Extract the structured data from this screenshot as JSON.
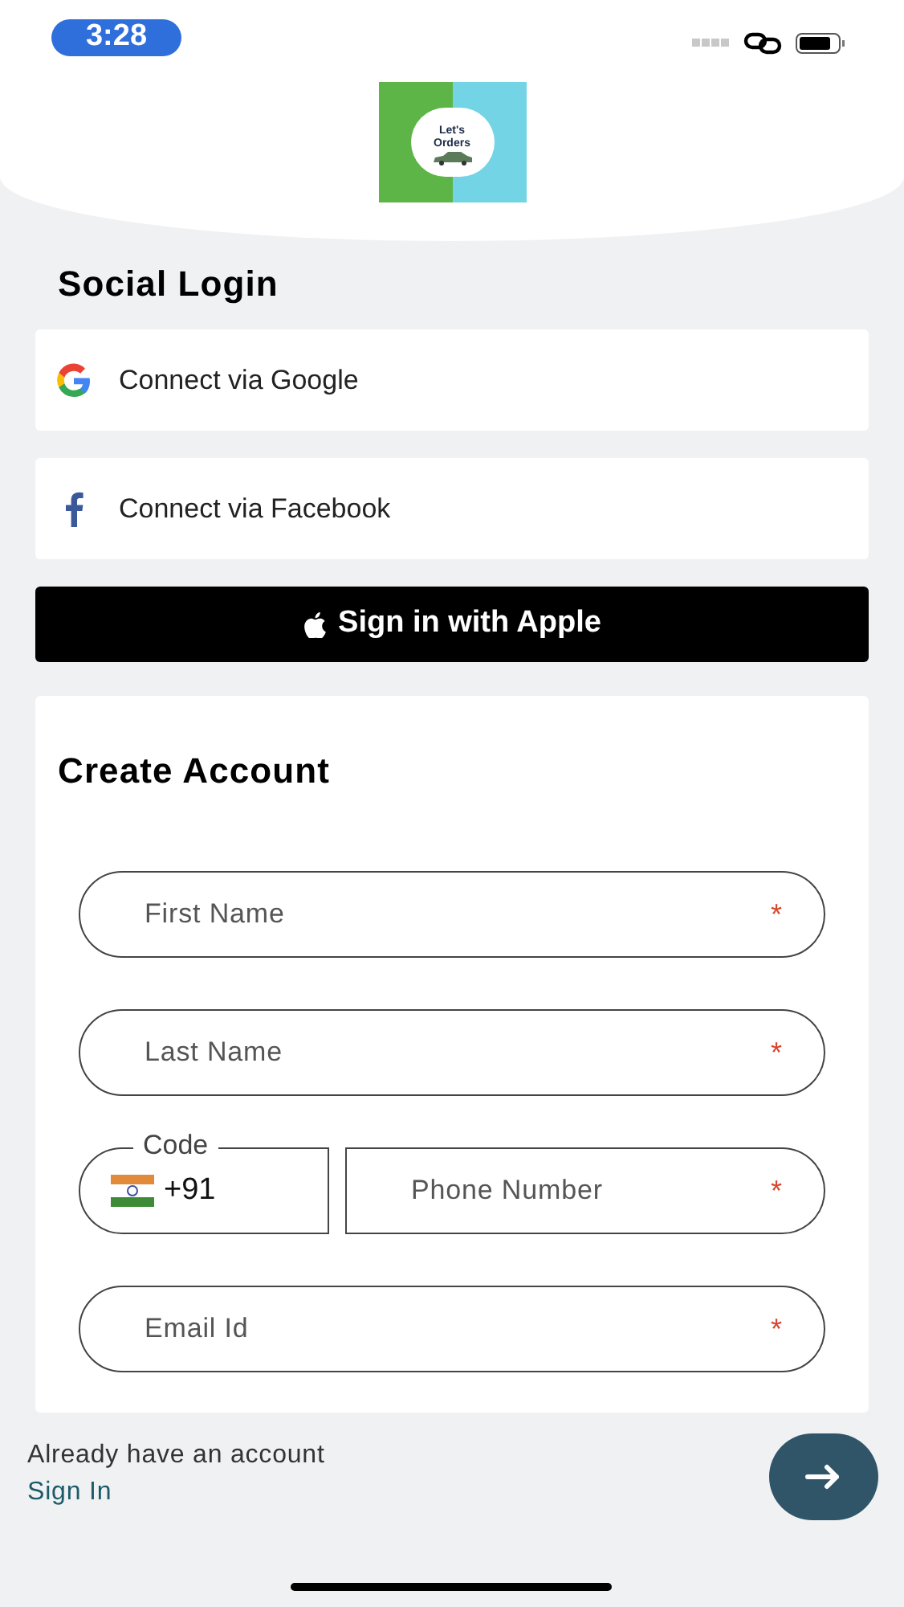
{
  "status_bar": {
    "time": "3:28"
  },
  "logo": {
    "line_1": "Let's",
    "line_2": "Orders"
  },
  "social_login": {
    "title": "Social Login",
    "buttons": [
      {
        "kind": "google",
        "label": "Connect via Google"
      },
      {
        "kind": "facebook",
        "label": "Connect via Facebook"
      },
      {
        "kind": "apple",
        "label": "Sign in with Apple"
      }
    ]
  },
  "create_account": {
    "title": "Create Account",
    "fields": [
      {
        "kind": "text",
        "placeholder": "First Name",
        "required_mark": "*"
      },
      {
        "kind": "text",
        "placeholder": "Last Name",
        "required_mark": "*"
      },
      {
        "kind": "phone",
        "code_label": "Code",
        "code_value": "+91",
        "placeholder": "Phone Number",
        "required_mark": "*"
      },
      {
        "kind": "text",
        "placeholder": "Email Id",
        "required_mark": "*"
      }
    ]
  },
  "footer": {
    "prompt": "Already have an account",
    "link": "Sign In"
  }
}
